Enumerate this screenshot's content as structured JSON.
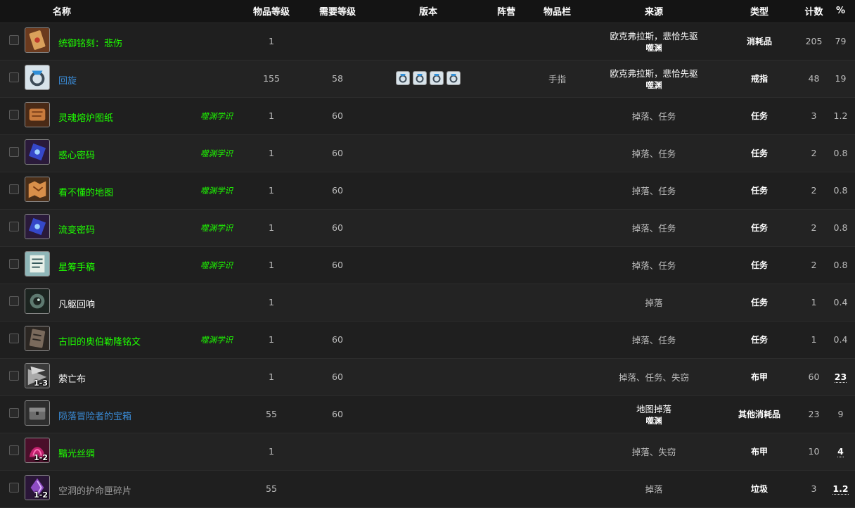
{
  "headers": {
    "name": "名称",
    "item_level": "物品等级",
    "req_level": "需要等级",
    "version": "版本",
    "faction": "阵营",
    "slot": "物品栏",
    "source": "来源",
    "type": "类型",
    "count": "计数",
    "percent": "%"
  },
  "colors": {
    "quality_uncommon": "#1eff00",
    "quality_rare": "#3a8bd6",
    "quality_common": "#ffffff",
    "quality_poor": "#9d9d9d",
    "background": "#1e1e1e"
  },
  "rows": [
    {
      "name": "统御铭刻：悲伤",
      "quality": "green",
      "icon": "inscription-icon",
      "stack": "",
      "tag": "",
      "ilvl": "1",
      "req": "",
      "version_icons": 0,
      "faction": "",
      "slot": "",
      "source": "欧克弗拉斯，悲恰先驱",
      "zone": "噬渊",
      "type": "消耗品",
      "count": "205",
      "pct": "79",
      "pct_underline": false
    },
    {
      "name": "回旋",
      "quality": "blue",
      "icon": "ring-icon",
      "stack": "",
      "tag": "",
      "ilvl": "155",
      "req": "58",
      "version_icons": 4,
      "faction": "",
      "slot": "手指",
      "source": "欧克弗拉斯，悲恰先驱",
      "zone": "噬渊",
      "type": "戒指",
      "count": "48",
      "pct": "19",
      "pct_underline": false
    },
    {
      "name": "灵魂熔炉图纸",
      "quality": "green",
      "icon": "scroll-icon",
      "stack": "",
      "tag": "噬渊学识",
      "ilvl": "1",
      "req": "60",
      "version_icons": 0,
      "faction": "",
      "slot": "",
      "source": "掉落、任务",
      "zone": "",
      "type": "任务",
      "count": "3",
      "pct": "1.2",
      "pct_underline": false
    },
    {
      "name": "惑心密码",
      "quality": "green",
      "icon": "cipher-icon",
      "stack": "",
      "tag": "噬渊学识",
      "ilvl": "1",
      "req": "60",
      "version_icons": 0,
      "faction": "",
      "slot": "",
      "source": "掉落、任务",
      "zone": "",
      "type": "任务",
      "count": "2",
      "pct": "0.8",
      "pct_underline": false
    },
    {
      "name": "看不懂的地图",
      "quality": "green",
      "icon": "map-icon",
      "stack": "",
      "tag": "噬渊学识",
      "ilvl": "1",
      "req": "60",
      "version_icons": 0,
      "faction": "",
      "slot": "",
      "source": "掉落、任务",
      "zone": "",
      "type": "任务",
      "count": "2",
      "pct": "0.8",
      "pct_underline": false
    },
    {
      "name": "流变密码",
      "quality": "green",
      "icon": "cipher-icon",
      "stack": "",
      "tag": "噬渊学识",
      "ilvl": "1",
      "req": "60",
      "version_icons": 0,
      "faction": "",
      "slot": "",
      "source": "掉落、任务",
      "zone": "",
      "type": "任务",
      "count": "2",
      "pct": "0.8",
      "pct_underline": false
    },
    {
      "name": "星筹手稿",
      "quality": "green",
      "icon": "manuscript-icon",
      "stack": "",
      "tag": "噬渊学识",
      "ilvl": "1",
      "req": "60",
      "version_icons": 0,
      "faction": "",
      "slot": "",
      "source": "掉落、任务",
      "zone": "",
      "type": "任务",
      "count": "2",
      "pct": "0.8",
      "pct_underline": false
    },
    {
      "name": "凡躯回响",
      "quality": "white",
      "icon": "echo-icon",
      "stack": "",
      "tag": "",
      "ilvl": "1",
      "req": "",
      "version_icons": 0,
      "faction": "",
      "slot": "",
      "source": "掉落",
      "zone": "",
      "type": "任务",
      "count": "1",
      "pct": "0.4",
      "pct_underline": false
    },
    {
      "name": "古旧的奥伯勒隆铭文",
      "quality": "green",
      "icon": "tablet-icon",
      "stack": "",
      "tag": "噬渊学识",
      "ilvl": "1",
      "req": "60",
      "version_icons": 0,
      "faction": "",
      "slot": "",
      "source": "掉落、任务",
      "zone": "",
      "type": "任务",
      "count": "1",
      "pct": "0.4",
      "pct_underline": false
    },
    {
      "name": "萦亡布",
      "quality": "white",
      "icon": "cloth-icon",
      "stack": "1-3",
      "tag": "",
      "ilvl": "1",
      "req": "60",
      "version_icons": 0,
      "faction": "",
      "slot": "",
      "source": "掉落、任务、失窃",
      "zone": "",
      "type": "布甲",
      "count": "60",
      "pct": "23",
      "pct_underline": true
    },
    {
      "name": "陨落冒险者的宝箱",
      "quality": "blue",
      "icon": "chest-icon",
      "stack": "",
      "tag": "",
      "ilvl": "55",
      "req": "60",
      "version_icons": 0,
      "faction": "",
      "slot": "",
      "source": "地图掉落",
      "zone": "噬渊",
      "type": "其他消耗品",
      "count": "23",
      "pct": "9",
      "pct_underline": false
    },
    {
      "name": "黯光丝绸",
      "quality": "green",
      "icon": "silk-icon",
      "stack": "1-2",
      "tag": "",
      "ilvl": "1",
      "req": "",
      "version_icons": 0,
      "faction": "",
      "slot": "",
      "source": "掉落、失窃",
      "zone": "",
      "type": "布甲",
      "count": "10",
      "pct": "4",
      "pct_underline": true
    },
    {
      "name": "空洞的护命匣碎片",
      "quality": "gray",
      "icon": "shard-icon",
      "stack": "1-2",
      "tag": "",
      "ilvl": "55",
      "req": "",
      "version_icons": 0,
      "faction": "",
      "slot": "",
      "source": "掉落",
      "zone": "",
      "type": "垃圾",
      "count": "3",
      "pct": "1.2",
      "pct_underline": true
    }
  ]
}
